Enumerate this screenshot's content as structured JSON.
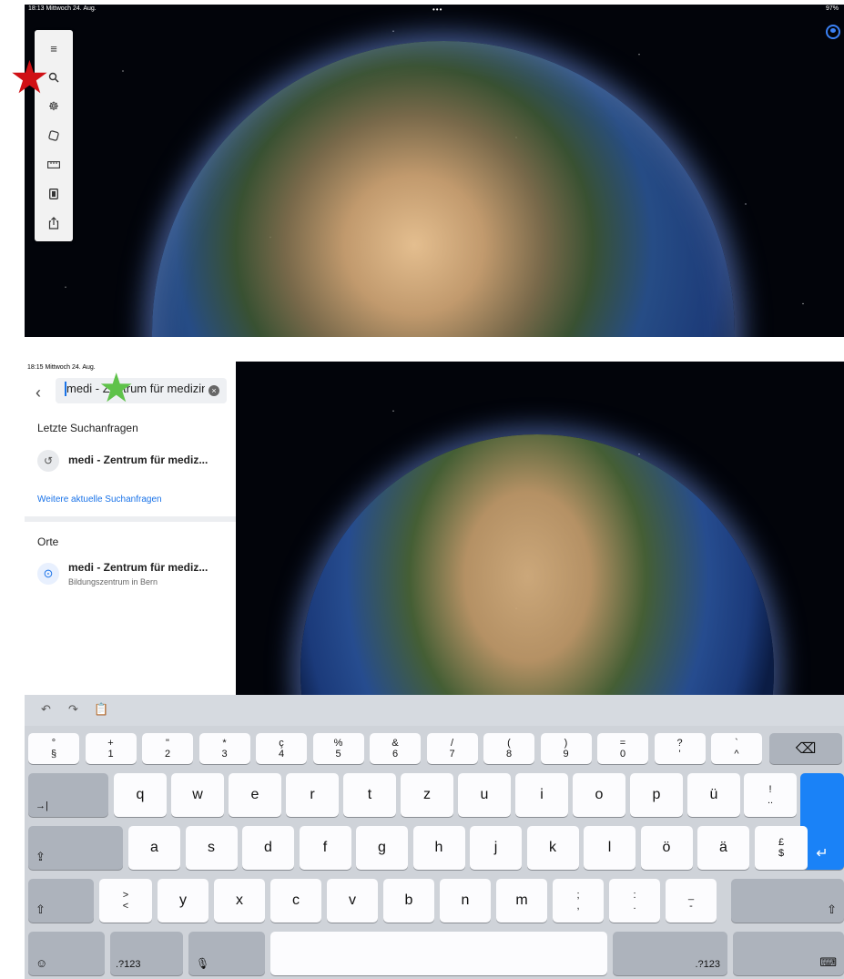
{
  "top_screen": {
    "status_time": "18:13  Mittwoch 24. Aug.",
    "status_right": "97%",
    "multitask_dots": "•••",
    "toolbar_icons": [
      "menu-icon",
      "search-icon",
      "voyager-icon",
      "dice-icon",
      "ruler-icon",
      "projects-icon",
      "share-icon"
    ]
  },
  "bottom_screen": {
    "status_time": "18:15  Mittwoch 24. Aug.",
    "search_value": "medi - Zentrum für medizini:",
    "recent_heading": "Letzte Suchanfragen",
    "recent_item": "medi - Zentrum für mediz...",
    "more_recent_link": "Weitere aktuelle Suchanfragen",
    "places_heading": "Orte",
    "place_title": "medi - Zentrum für mediz...",
    "place_subtitle": "Bildungszentrum in Bern"
  },
  "keyboard": {
    "number_row": [
      {
        "top": "°",
        "bottom": "§"
      },
      {
        "top": "+",
        "bottom": "1"
      },
      {
        "top": "\"",
        "bottom": "2"
      },
      {
        "top": "*",
        "bottom": "3"
      },
      {
        "top": "ç",
        "bottom": "4"
      },
      {
        "top": "%",
        "bottom": "5"
      },
      {
        "top": "&",
        "bottom": "6"
      },
      {
        "top": "/",
        "bottom": "7"
      },
      {
        "top": "(",
        "bottom": "8"
      },
      {
        "top": ")",
        "bottom": "9"
      },
      {
        "top": "=",
        "bottom": "0"
      },
      {
        "top": "?",
        "bottom": "'"
      },
      {
        "top": "`",
        "bottom": "^"
      }
    ],
    "row_q": [
      "q",
      "w",
      "e",
      "r",
      "t",
      "z",
      "u",
      "i",
      "o",
      "p",
      "ü"
    ],
    "row_q_last": {
      "top": "!",
      "bottom": ".."
    },
    "row_a": [
      "a",
      "s",
      "d",
      "f",
      "g",
      "h",
      "j",
      "k",
      "l",
      "ö",
      "ä"
    ],
    "row_a_last": {
      "top": "£",
      "bottom": "$"
    },
    "row_y_first": {
      "top": ">",
      "bottom": "<"
    },
    "row_y": [
      "y",
      "x",
      "c",
      "v",
      "b",
      "n",
      "m"
    ],
    "row_y_punct": [
      {
        "top": ";",
        "bottom": ","
      },
      {
        "top": ":",
        "bottom": "."
      },
      {
        "top": "_",
        "bottom": "-"
      }
    ],
    "tab_label": "→|",
    "delete_label": "⌫",
    "return_label": "↵",
    "caps_label": "⇪",
    "shift_label": "⇧",
    "emoji_label": "☺",
    "num_label": ".?123",
    "mic_label": "🎙",
    "hide_label": "⌨"
  }
}
